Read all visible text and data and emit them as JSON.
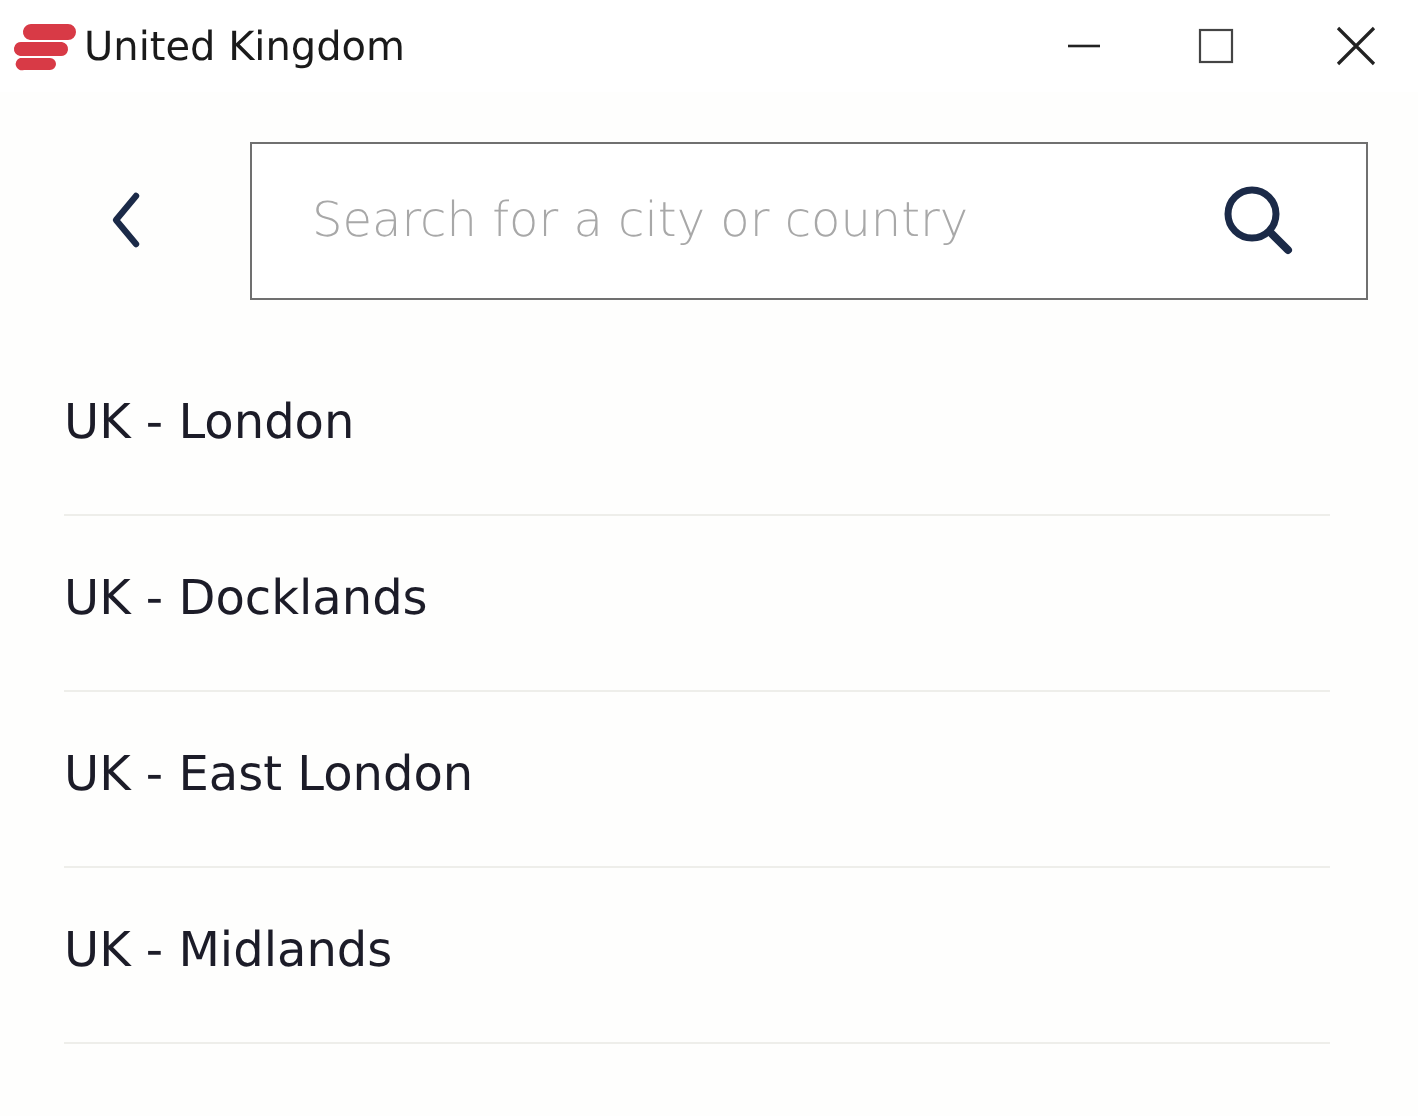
{
  "window": {
    "title": "United Kingdom"
  },
  "search": {
    "placeholder": "Search for a city or country"
  },
  "locations": [
    {
      "name": "UK - London"
    },
    {
      "name": "UK - Docklands"
    },
    {
      "name": "UK - East London"
    },
    {
      "name": "UK - Midlands"
    }
  ]
}
